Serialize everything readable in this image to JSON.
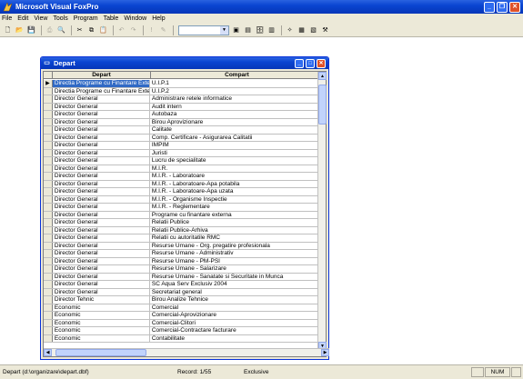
{
  "app": {
    "title": "Microsoft Visual FoxPro"
  },
  "menu": [
    "File",
    "Edit",
    "View",
    "Tools",
    "Program",
    "Table",
    "Window",
    "Help"
  ],
  "window": {
    "title": "Depart",
    "columns": [
      "Depart",
      "Compart"
    ],
    "rows": [
      [
        "Directia Programe cu Finantare Externa",
        "U.I.P.1"
      ],
      [
        "Directia Programe cu Finantare Externa",
        "U.I.P.2"
      ],
      [
        "Director General",
        "Administrare retele informatice"
      ],
      [
        "Director General",
        "Audit intern"
      ],
      [
        "Director General",
        "Autobaza"
      ],
      [
        "Director General",
        "Birou Aprovizionare"
      ],
      [
        "Director General",
        "Calitate"
      ],
      [
        "Director General",
        "Comp. Certificare - Asigurarea Calitatii"
      ],
      [
        "Director General",
        "IMPIM"
      ],
      [
        "Director General",
        "Juristi"
      ],
      [
        "Director General",
        "Lucru de specialitate"
      ],
      [
        "Director General",
        "M.I.R."
      ],
      [
        "Director General",
        "M.I.R. - Laboratoare"
      ],
      [
        "Director General",
        "M.I.R. - Laboratoare-Apa potabila"
      ],
      [
        "Director General",
        "M.I.R. - Laboratoare-Apa uzata"
      ],
      [
        "Director General",
        "M.I.R. - Organisme Inspectie"
      ],
      [
        "Director General",
        "M.I.R. - Reglementare"
      ],
      [
        "Director General",
        "Programe cu finantare externa"
      ],
      [
        "Director General",
        "Relatii Publice"
      ],
      [
        "Director General",
        "Relatii Publice-Arhiva"
      ],
      [
        "Director General",
        "Relatii cu autoritatile RMC"
      ],
      [
        "Director General",
        "Resurse Umane - Org. pregatire profesionala"
      ],
      [
        "Director General",
        "Resurse Umane - Administrativ"
      ],
      [
        "Director General",
        "Resurse Umane - PM-PSI"
      ],
      [
        "Director General",
        "Resurse Umane - Salarizare"
      ],
      [
        "Director General",
        "Resurse Umane - Sanatate si Securitate in Munca"
      ],
      [
        "Director General",
        "SC Aqua Serv Exclusiv 2004"
      ],
      [
        "Director General",
        "Secretariat general"
      ],
      [
        "Director Tehnic",
        "Birou Analize Tehnice"
      ],
      [
        "Economic",
        "Comercial"
      ],
      [
        "Economic",
        "Comercial-Aprovizionare"
      ],
      [
        "Economic",
        "Comercial-Clitori"
      ],
      [
        "Economic",
        "Comercial-Contractare facturare"
      ],
      [
        "Economic",
        "Contabilitate"
      ]
    ]
  },
  "status": {
    "path": "Depart (d:\\organizare\\depart.dbf)",
    "record": "Record: 1/55",
    "mode": "Exclusive",
    "num": "NUM"
  }
}
